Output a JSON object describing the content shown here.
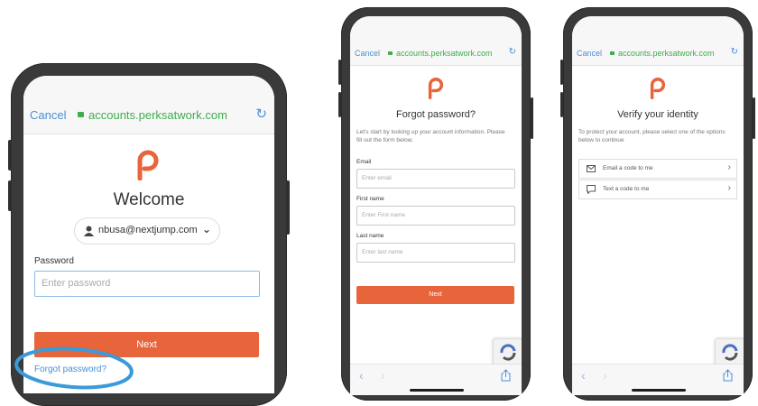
{
  "screen1": {
    "cancel": "Cancel",
    "url": "accounts.perksatwork.com",
    "title": "Welcome",
    "account": "nbusa@nextjump.com",
    "password_label": "Password",
    "password_placeholder": "Enter password",
    "next": "Next",
    "forgot": "Forgot password?"
  },
  "screen2": {
    "cancel": "Cancel",
    "url": "accounts.perksatwork.com",
    "title": "Forgot password?",
    "intro": "Let's start by looking up your account information. Please fill out the form below.",
    "email_label": "Email",
    "email_placeholder": "Enter email",
    "first_label": "First name",
    "first_placeholder": "Enter First name",
    "last_label": "Last name",
    "last_placeholder": "Enter last name",
    "next": "Next"
  },
  "screen3": {
    "cancel": "Cancel",
    "url": "accounts.perksatwork.com",
    "title": "Verify your identity",
    "intro": "To protect your account, please select one of the options below to continue",
    "option_email": "Email a code to me",
    "option_text": "Text a code to me"
  },
  "icons": {
    "logo": "perks-logo-icon",
    "lock": "lock-icon",
    "reload": "reload-icon",
    "user": "user-icon",
    "chevron": "chevron-down-icon",
    "mail": "mail-icon",
    "message": "message-icon",
    "back": "back-arrow-icon",
    "forward": "forward-arrow-icon",
    "share": "share-icon",
    "recaptcha": "recaptcha-icon"
  },
  "colors": {
    "accent": "#e8643a",
    "link": "#4a8fd6",
    "url": "#3fae4c",
    "highlight_circle": "#3a9bd8"
  }
}
